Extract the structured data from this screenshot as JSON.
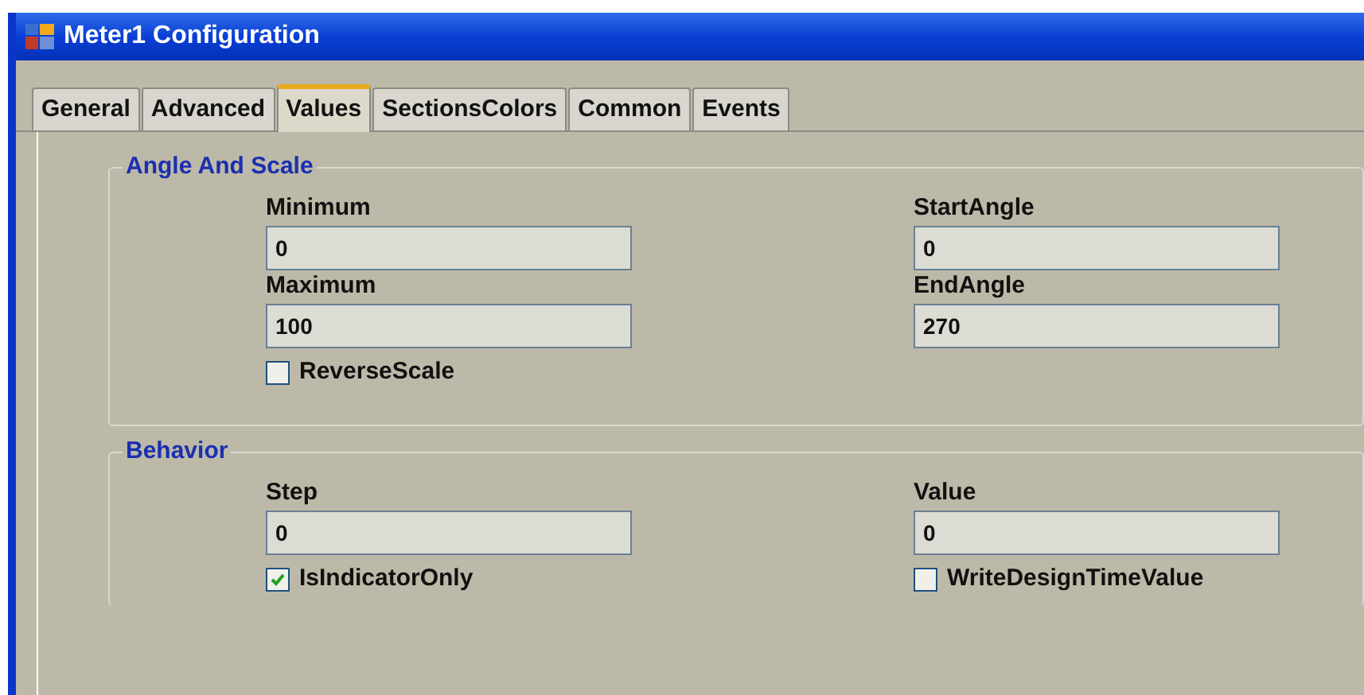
{
  "window": {
    "title": "Meter1 Configuration"
  },
  "tabs": [
    {
      "label": "General",
      "selected": false
    },
    {
      "label": "Advanced",
      "selected": false
    },
    {
      "label": "Values",
      "selected": true
    },
    {
      "label": "SectionsColors",
      "selected": false
    },
    {
      "label": "Common",
      "selected": false
    },
    {
      "label": "Events",
      "selected": false
    }
  ],
  "groups": [
    {
      "title": "Angle And Scale",
      "fields": [
        {
          "label": "Minimum",
          "value": "0"
        },
        {
          "label": "StartAngle",
          "value": "0"
        },
        {
          "label": "Maximum",
          "value": "100"
        },
        {
          "label": "EndAngle",
          "value": "270"
        }
      ],
      "checkboxes": [
        {
          "label": "ReverseScale",
          "checked": false
        }
      ]
    },
    {
      "title": "Behavior",
      "fields": [
        {
          "label": "Step",
          "value": "0"
        },
        {
          "label": "Value",
          "value": "0"
        }
      ],
      "checkboxes": [
        {
          "label": "IsIndicatorOnly",
          "checked": true
        },
        {
          "label": "WriteDesignTimeValue",
          "checked": false
        }
      ]
    }
  ]
}
